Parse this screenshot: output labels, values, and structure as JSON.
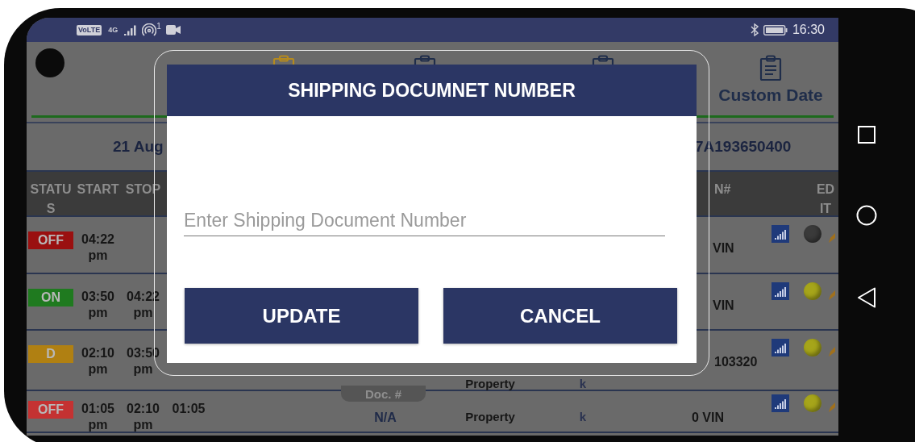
{
  "status_bar": {
    "badges": [
      "VoLTE",
      "4G"
    ],
    "hotspot_count": "1",
    "time": "16:30"
  },
  "tabs": [
    {
      "color": "#b58a1e"
    },
    {
      "color": "#1f2d4a"
    },
    {
      "color": "#1f2d4a"
    },
    {
      "label": "Custom Date",
      "color": "#1f2d4a"
    }
  ],
  "summary": {
    "date": "21 Aug",
    "id": "7A193650400"
  },
  "table": {
    "columns": [
      "STATUS",
      "START",
      "STOP",
      "N#",
      "EDIT"
    ],
    "rows": [
      {
        "status": {
          "label": "OFF",
          "color": "#9a1010"
        },
        "start": "04:22 pm",
        "vin": "VIN",
        "indicator": {
          "color": "#3a3a3a"
        }
      },
      {
        "status": {
          "label": "ON",
          "color": "#1f7a1f"
        },
        "start": "03:50 pm",
        "stop": "04:22 pm",
        "vin": "VIN",
        "indicator": {
          "color": "#a6a51a"
        }
      },
      {
        "status": {
          "label": "D",
          "color": "#b08012"
        },
        "start": "02:10 pm",
        "stop": "03:50 pm",
        "doc_button": "Doc. #",
        "type": "Property",
        "unit": "k",
        "vin": "103320",
        "indicator": {
          "color": "#a6a51a"
        }
      },
      {
        "status": {
          "label": "OFF",
          "color": "#c43232"
        },
        "start": "01:05 pm",
        "stop": "02:10 pm",
        "duration": "01:05",
        "doc": "N/A",
        "type": "Property",
        "unit": "k",
        "vin": "0 VIN",
        "indicator": {
          "color": "#a6a51a"
        }
      }
    ]
  },
  "dialog": {
    "title": "SHIPPING DOCUMNET NUMBER",
    "placeholder": "Enter Shipping Document Number",
    "buttons": [
      "UPDATE",
      "CANCEL"
    ]
  }
}
